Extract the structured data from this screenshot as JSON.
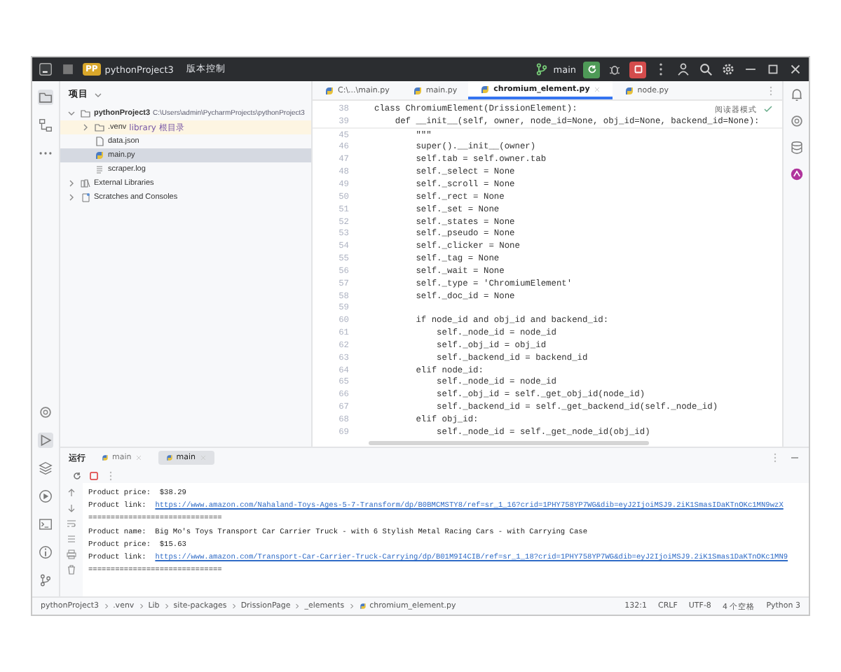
{
  "title_bar": {
    "project_badge": "PP",
    "project": "pythonProject3",
    "vcs": "版本控制",
    "branch": "main"
  },
  "project_panel": {
    "title": "项目",
    "tree": [
      {
        "label": "pythonProject3",
        "note": "C:\\Users\\admin\\PycharmProjects\\pythonProject3",
        "kind": "project",
        "expanded": true,
        "selected": false,
        "children": [
          {
            "label": ".venv",
            "note": "library 根目录",
            "kind": "library-root",
            "expanded": false,
            "selected": false
          },
          {
            "label": "data.json",
            "kind": "json",
            "selected": false
          },
          {
            "label": "main.py",
            "kind": "python",
            "selected": true
          },
          {
            "label": "scraper.log",
            "kind": "log",
            "selected": false
          }
        ]
      },
      {
        "label": "External Libraries",
        "kind": "libraries",
        "expanded": false,
        "selected": false
      },
      {
        "label": "Scratches and Consoles",
        "kind": "scratches",
        "expanded": false,
        "selected": false
      }
    ]
  },
  "editor": {
    "tabs": [
      {
        "label": "C:\\...\\main.py",
        "selected": false
      },
      {
        "label": "main.py",
        "selected": false
      },
      {
        "label": "chromium_element.py",
        "selected": true
      },
      {
        "label": "node.py",
        "selected": false
      }
    ],
    "reader_mode": "阅读器模式",
    "lines": [
      {
        "number": "38",
        "text": "class ChromiumElement(DrissionElement):"
      },
      {
        "number": "39",
        "text": "    def __init__(self, owner, node_id=None, obj_id=None, backend_id=None):"
      },
      {
        "number": "45",
        "text": "        \"\"\""
      },
      {
        "number": "46",
        "text": "        super().__init__(owner)"
      },
      {
        "number": "47",
        "text": "        self.tab = self.owner.tab"
      },
      {
        "number": "48",
        "text": "        self._select = None"
      },
      {
        "number": "49",
        "text": "        self._scroll = None"
      },
      {
        "number": "50",
        "text": "        self._rect = None"
      },
      {
        "number": "51",
        "text": "        self._set = None"
      },
      {
        "number": "52",
        "text": "        self._states = None"
      },
      {
        "number": "53",
        "text": "        self._pseudo = None"
      },
      {
        "number": "54",
        "text": "        self._clicker = None"
      },
      {
        "number": "55",
        "text": "        self._tag = None"
      },
      {
        "number": "56",
        "text": "        self._wait = None"
      },
      {
        "number": "57",
        "text": "        self._type = 'ChromiumElement'"
      },
      {
        "number": "58",
        "text": "        self._doc_id = None"
      },
      {
        "number": "59"
      },
      {
        "number": "60",
        "text": "        if node_id and obj_id and backend_id:"
      },
      {
        "number": "61",
        "text": "            self._node_id = node_id"
      },
      {
        "number": "62",
        "text": "            self._obj_id = obj_id"
      },
      {
        "number": "63",
        "text": "            self._backend_id = backend_id"
      },
      {
        "number": "64",
        "text": "        elif node_id:"
      },
      {
        "number": "65",
        "text": "            self._node_id = node_id"
      },
      {
        "number": "66",
        "text": "            self._obj_id = self._get_obj_id(node_id)"
      },
      {
        "number": "67",
        "text": "            self._backend_id = self._get_backend_id(self._node_id)"
      },
      {
        "number": "68",
        "text": "        elif obj_id:"
      },
      {
        "number": "69",
        "text": "            self._node_id = self._get_node_id(obj_id)"
      }
    ]
  },
  "run_panel": {
    "title": "运行",
    "tabs": [
      {
        "label": "main",
        "selected": false
      },
      {
        "label": "main",
        "selected": true
      }
    ],
    "output": [
      {
        "kind": "text",
        "text": "Product price:  $38.29"
      },
      {
        "kind": "link",
        "prefix": "Product link:  ",
        "link": "https://www.amazon.com/Nahaland-Toys-Ages-5-7-Transform/dp/B0BMCMSTY8/ref=sr_1_16?crid=1PHY758YP7WG&dib=eyJ2IjoiMSJ9.2iK1SmasIDaKTnOKc1MN9wzX"
      },
      {
        "kind": "text",
        "text": "=============================="
      },
      {
        "kind": "text",
        "text": "Product name:  Big Mo's Toys Transport Car Carrier Truck - with 6 Stylish Metal Racing Cars - with Carrying Case"
      },
      {
        "kind": "text",
        "text": "Product price:  $15.63"
      },
      {
        "kind": "link",
        "prefix": "Product link:  ",
        "link": "https://www.amazon.com/Transport-Car-Carrier-Truck-Carrying/dp/B01M9I4CIB/ref=sr_1_18?crid=1PHY758YP7WG&dib=eyJ2IjoiMSJ9.2iK1Smas1DaKTnOKc1MN9"
      },
      {
        "kind": "text",
        "text": "=============================="
      }
    ]
  },
  "status_bar": {
    "breadcrumbs": [
      "pythonProject3",
      ".venv",
      "Lib",
      "site-packages",
      "DrissionPage",
      "_elements",
      "chromium_element.py"
    ],
    "items": [
      "132:1",
      "CRLF",
      "UTF-8",
      "4 个空格",
      "Python 3"
    ]
  }
}
